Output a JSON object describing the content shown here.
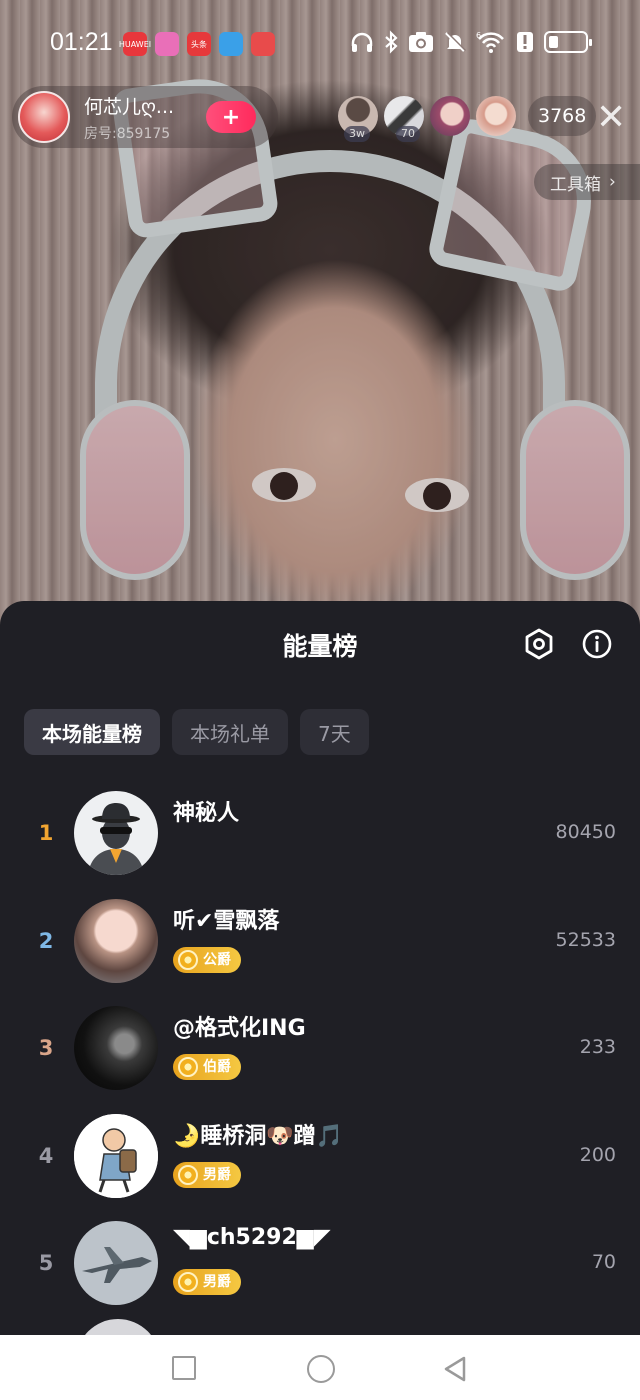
{
  "status_bar": {
    "time": "01:21",
    "notification_icons": [
      {
        "name": "huawei-appgallery-icon",
        "color": "#e8373c",
        "label": "HUAWEI"
      },
      {
        "name": "colorful-app-icon",
        "color": "#e96fb8",
        "label": ""
      },
      {
        "name": "toutiao-icon",
        "color": "#e6393b",
        "label": "头条"
      },
      {
        "name": "blue-app-icon",
        "color": "#3aa0e8",
        "label": ""
      },
      {
        "name": "calendar-app-icon",
        "color": "#e84b4b",
        "label": ""
      }
    ],
    "system_icons": [
      "headphones-icon",
      "bluetooth-icon",
      "camera-icon",
      "mute-icon",
      "wifi-6-icon",
      "alert-icon",
      "battery-icon"
    ],
    "battery_level": 0.25
  },
  "host": {
    "name": "何芯儿ღ...",
    "room_id": "房号:859175",
    "follow_label": "+"
  },
  "viewers": {
    "avatars": [
      {
        "badge": "3w"
      },
      {
        "badge": "70"
      },
      {
        "badge": ""
      },
      {
        "badge": ""
      }
    ],
    "count": "3768"
  },
  "close_label": "✕",
  "toolbox": {
    "label": "工具箱",
    "chevron": "›"
  },
  "leaderboard": {
    "title": "能量榜",
    "tabs": [
      {
        "label": "本场能量榜",
        "active": true
      },
      {
        "label": "本场礼单",
        "active": false
      },
      {
        "label": "7天",
        "active": false
      }
    ],
    "rows": [
      {
        "rank": "1",
        "rank_color": "#f2a531",
        "name": "神秘人",
        "badge": "",
        "score": "80450",
        "avatar": "mystery"
      },
      {
        "rank": "2",
        "rank_color": "#7fb8e6",
        "name": "听✔雪飘落",
        "badge": "公爵",
        "score": "52533",
        "avatar": "child"
      },
      {
        "rank": "3",
        "rank_color": "#d9a58a",
        "name": "@格式化ING",
        "badge": "伯爵",
        "score": "233",
        "avatar": "dark"
      },
      {
        "rank": "4",
        "rank_color": "#9a9aa4",
        "name": "🌛睡桥洞🐶蹭🎵",
        "badge": "男爵",
        "score": "200",
        "avatar": "cartoon"
      },
      {
        "rank": "5",
        "rank_color": "#9a9aa4",
        "name": "◥▆ch5292▆◤",
        "badge": "男爵",
        "score": "70",
        "avatar": "jet"
      }
    ]
  },
  "nav": {
    "buttons": [
      "recent-apps",
      "home",
      "back"
    ]
  }
}
